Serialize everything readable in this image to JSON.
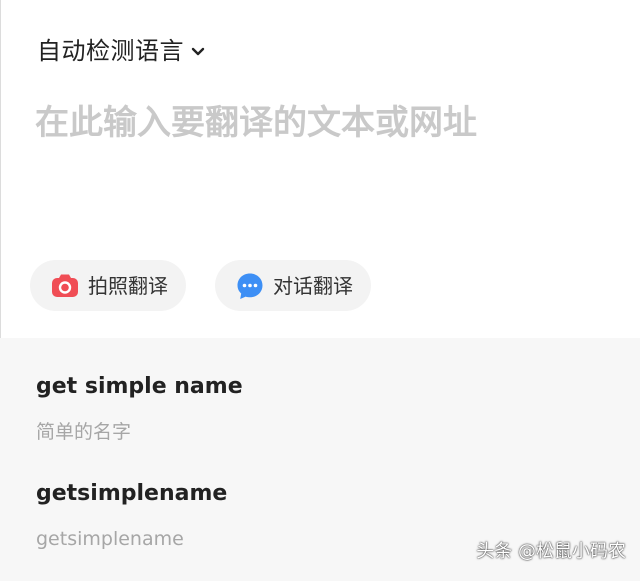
{
  "header": {
    "language_label": "自动检测语言",
    "language_dropdown_icon": "chevron-down-icon"
  },
  "input": {
    "value": "",
    "placeholder": "在此输入要翻译的文本或网址"
  },
  "actions": {
    "camera": {
      "label": "拍照翻译",
      "icon": "camera-icon",
      "color": "#f04d55"
    },
    "chat": {
      "label": "对话翻译",
      "icon": "chat-bubble-icon",
      "color": "#3d8ff5"
    }
  },
  "results": [
    {
      "title": "get simple name",
      "subtitle": "简单的名字"
    },
    {
      "title": "getsimplename",
      "subtitle": "getsimplename"
    }
  ],
  "watermark": "头条 @松鼠小码农"
}
